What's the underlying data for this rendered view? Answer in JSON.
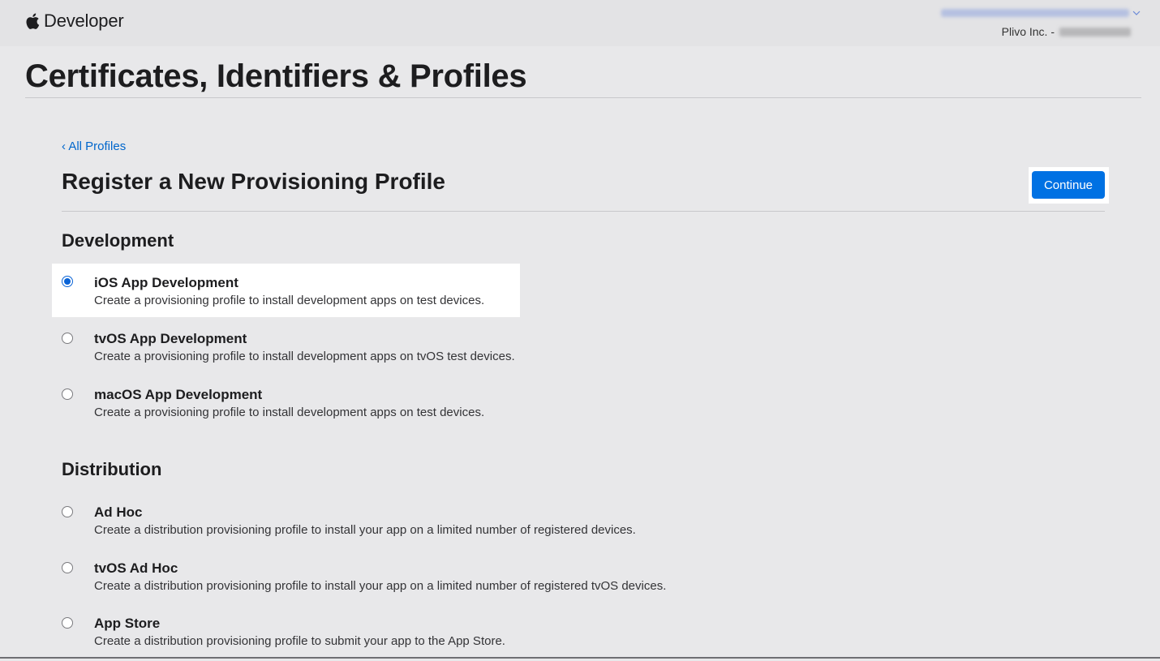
{
  "header": {
    "brand": "Developer",
    "org_label": "Plivo Inc. -"
  },
  "page": {
    "title": "Certificates, Identifiers & Profiles",
    "back_link": "‹ All Profiles",
    "heading": "Register a New Provisioning Profile",
    "continue_label": "Continue"
  },
  "development": {
    "heading": "Development",
    "options": [
      {
        "title": "iOS App Development",
        "description": "Create a provisioning profile to install development apps on test devices.",
        "selected": true
      },
      {
        "title": "tvOS App Development",
        "description": "Create a provisioning profile to install development apps on tvOS test devices.",
        "selected": false
      },
      {
        "title": "macOS App Development",
        "description": "Create a provisioning profile to install development apps on test devices.",
        "selected": false
      }
    ]
  },
  "distribution": {
    "heading": "Distribution",
    "options": [
      {
        "title": "Ad Hoc",
        "description": "Create a distribution provisioning profile to install your app on a limited number of registered devices.",
        "selected": false
      },
      {
        "title": "tvOS Ad Hoc",
        "description": "Create a distribution provisioning profile to install your app on a limited number of registered tvOS devices.",
        "selected": false
      },
      {
        "title": "App Store",
        "description": "Create a distribution provisioning profile to submit your app to the App Store.",
        "selected": false
      }
    ]
  },
  "colors": {
    "accent": "#0071e3",
    "link": "#0066cc",
    "background": "#e8e8ea"
  }
}
